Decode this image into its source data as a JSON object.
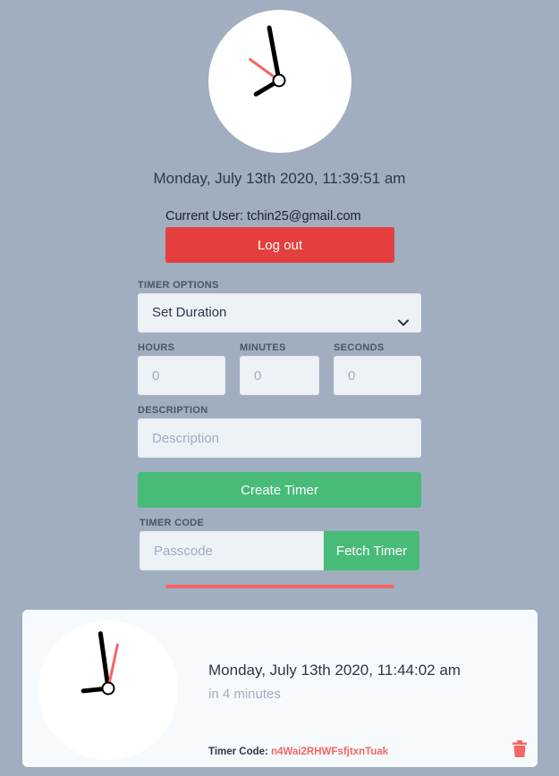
{
  "current_time": {
    "datetime": "Monday, July 13th 2020, 11:39:51 am",
    "clock": {
      "hour": 11,
      "minute": 39,
      "second": 51
    }
  },
  "user": {
    "label": "Current User: tchin25@gmail.com",
    "logout_label": "Log out"
  },
  "form": {
    "timer_options_label": "TIMER OPTIONS",
    "timer_option_selected": "Set Duration",
    "hours_label": "HOURS",
    "hours_placeholder": "0",
    "minutes_label": "MINUTES",
    "minutes_placeholder": "0",
    "seconds_label": "SECONDS",
    "seconds_placeholder": "0",
    "description_label": "DESCRIPTION",
    "description_placeholder": "Description",
    "create_label": "Create Timer",
    "timer_code_label": "TIMER CODE",
    "passcode_placeholder": "Passcode",
    "fetch_label": "Fetch Timer"
  },
  "timer_card": {
    "datetime": "Monday, July 13th 2020, 11:44:02 am",
    "relative": "in 4 minutes",
    "code_label": "Timer Code:",
    "code_value": "n4Wai2RHWFsfjtxnTuak",
    "clock": {
      "hour": 11,
      "minute": 44,
      "second": 2
    }
  },
  "colors": {
    "background": "#a0aec0",
    "danger": "#e53e3e",
    "success": "#48bb78",
    "accent_red": "#f56565"
  },
  "icons": {
    "select_arrow": "chevron-down-icon",
    "delete": "trash-icon"
  }
}
